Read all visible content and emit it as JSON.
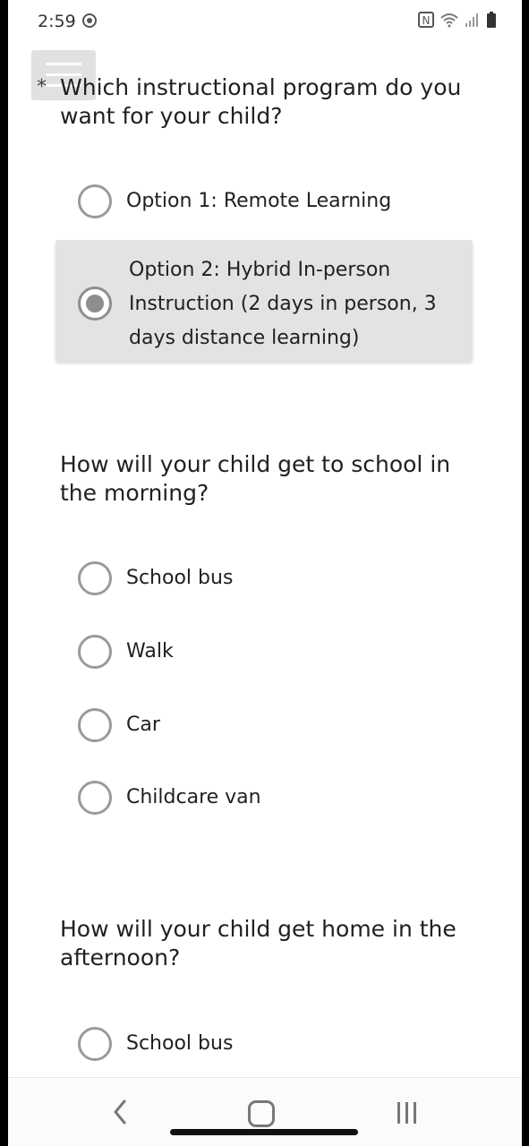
{
  "status_bar": {
    "time": "2:59",
    "left_icon": "chat-bubble-icon",
    "right_icons": [
      "nfc-icon",
      "wifi-icon",
      "signal-icon",
      "battery-icon"
    ]
  },
  "menu_icon": "hamburger-menu-icon",
  "q1": {
    "required_marker": "*",
    "text": "Which instructional program do you want for your child?",
    "options": [
      {
        "label": "Option 1: Remote Learning",
        "selected": false
      },
      {
        "label": "Option 2: Hybrid In-person Instruction (2 days in person, 3 days distance learning)",
        "selected": true
      }
    ]
  },
  "q2": {
    "text": "How will your child get to school in the morning?",
    "options": [
      {
        "label": "School bus",
        "selected": false
      },
      {
        "label": "Walk",
        "selected": false
      },
      {
        "label": "Car",
        "selected": false
      },
      {
        "label": "Childcare van",
        "selected": false
      }
    ]
  },
  "q3": {
    "text": "How will your child get home in the afternoon?",
    "options": [
      {
        "label": "School bus",
        "selected": false
      }
    ]
  },
  "nav_bar": {
    "back_icon": "chevron-left-icon",
    "home_icon": "home-icon",
    "recents_icon": "recents-icon"
  },
  "colors": {
    "selected_bg": "#e3e3e3",
    "radio_border": "#9a9a9a",
    "text": "#202124"
  }
}
